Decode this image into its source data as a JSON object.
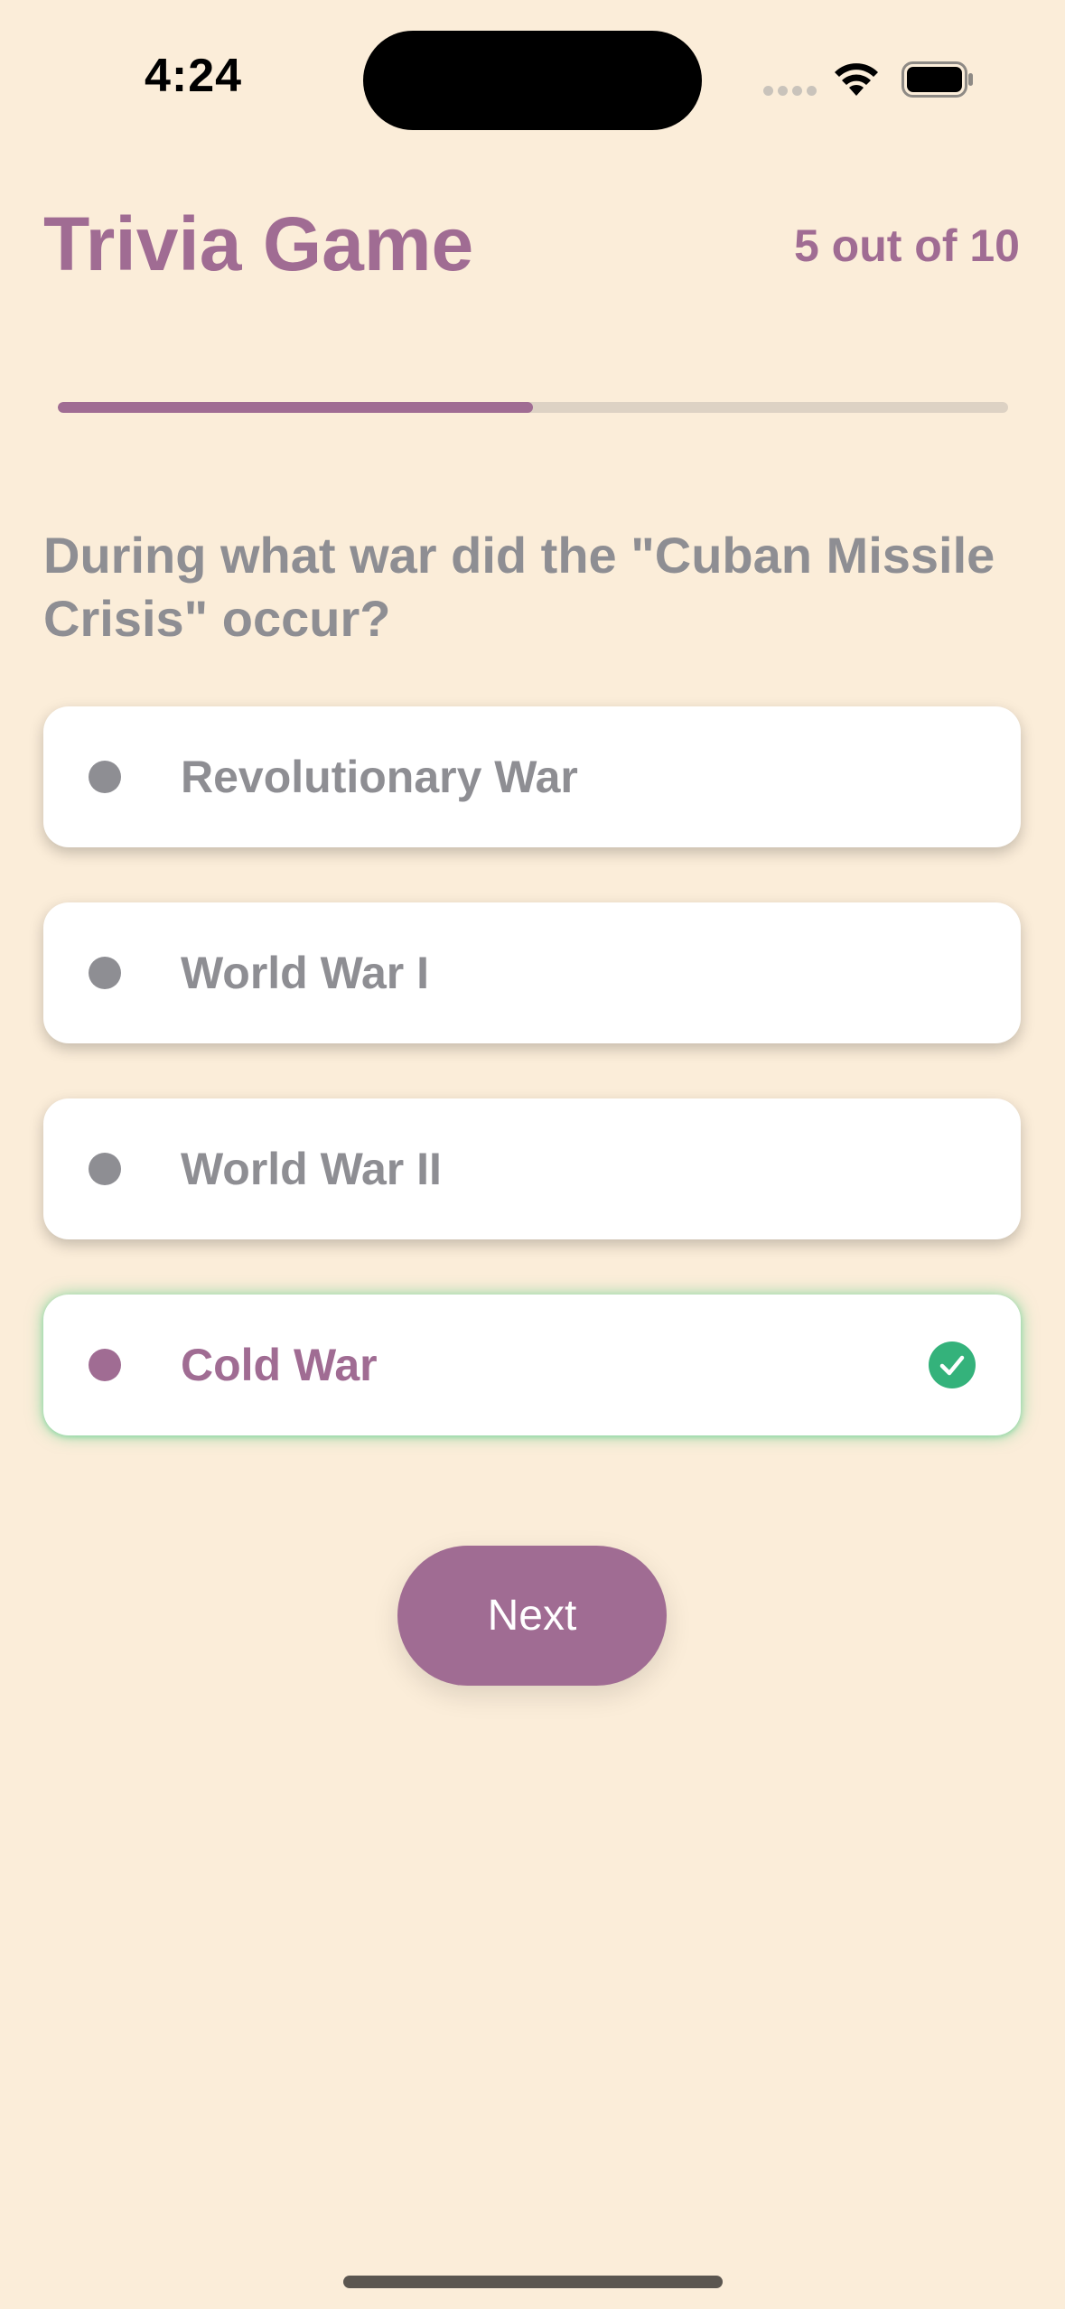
{
  "status_bar": {
    "time": "4:24",
    "icons": [
      "cellular-signal-icon",
      "wifi-icon",
      "battery-icon"
    ]
  },
  "header": {
    "title": "Trivia Game",
    "progress_text": "5 out of 10"
  },
  "progress": {
    "current": 5,
    "total": 10,
    "fraction": 0.5
  },
  "question": {
    "text": "During what war did the \"Cuban Missile Crisis\" occur?"
  },
  "options": [
    {
      "label": "Revolutionary War",
      "correct": false
    },
    {
      "label": "World War I",
      "correct": false
    },
    {
      "label": "World War II",
      "correct": false
    },
    {
      "label": "Cold War",
      "correct": true,
      "icon": "checkmark-circle-icon"
    }
  ],
  "next_button": {
    "label": "Next"
  },
  "colors": {
    "background": "#FBEDD9",
    "accent": "#A06C93",
    "muted_text": "#8E8E93",
    "progress_track": "#DDD2C4",
    "correct_green": "#34B27B"
  }
}
